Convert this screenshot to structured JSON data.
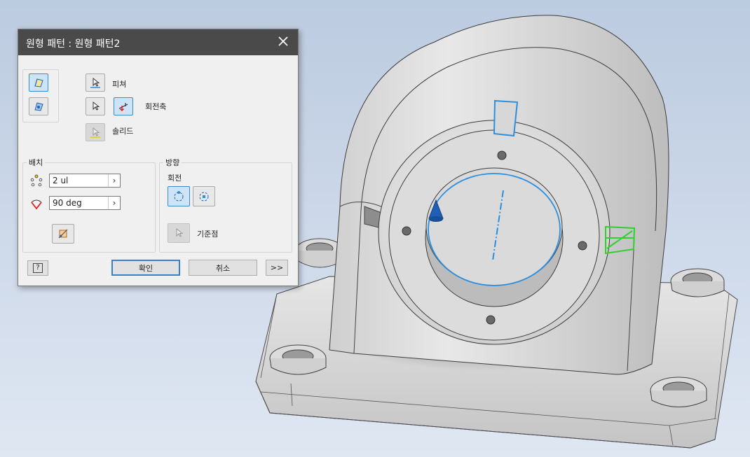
{
  "dialog": {
    "title": "원형 패턴 : 원형 패턴2",
    "labels": {
      "features": "피쳐",
      "rotation_axis": "회전축",
      "solids": "솔리드"
    },
    "placement": {
      "title": "배치",
      "count_value": "2 ul",
      "angle_value": "90 deg"
    },
    "orientation": {
      "title": "방향",
      "rotation_label": "회전",
      "base_point_label": "기준점"
    },
    "buttons": {
      "help": "?",
      "ok": "확인",
      "cancel": "취소",
      "more": ">>"
    }
  },
  "icons": {
    "close": "close-icon",
    "pattern_features": "pattern-features-icon",
    "pattern_solid": "pattern-solid-icon",
    "select_features": "select-arrow-icon",
    "select_axis": "select-arrow-icon",
    "flip_axis": "flip-axis-icon",
    "select_solid": "select-arrow-icon",
    "count": "circular-count-icon",
    "angle": "angle-icon",
    "fit_midplane": "midplane-icon",
    "rotational": "rotational-orientation-icon",
    "fixed": "fixed-orientation-icon",
    "base_point": "select-arrow-icon"
  },
  "colors": {
    "title_bar": "#4a4a4a",
    "active_blue": "#3c8ad6",
    "axis_highlight": "#2b8fe0",
    "feature_green": "#2fd02f"
  }
}
